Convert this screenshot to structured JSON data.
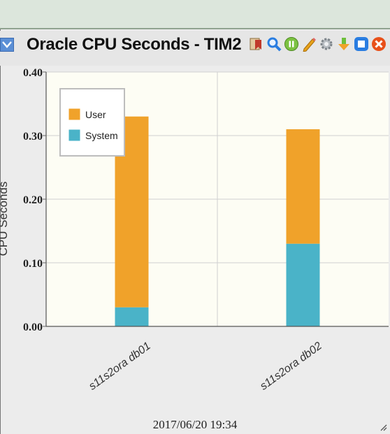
{
  "widget": {
    "title": "Oracle CPU Seconds - TIM2",
    "timestamp": "2017/06/20 19:34",
    "toolbar": [
      {
        "name": "bookmark-icon",
        "color": "#c0392b"
      },
      {
        "name": "search-icon",
        "color": "#2a7de1"
      },
      {
        "name": "pause-icon",
        "color": "#7cc242"
      },
      {
        "name": "edit-icon",
        "color": "#e8a21a"
      },
      {
        "name": "settings-icon",
        "color": "#9aa0a6"
      },
      {
        "name": "download-icon",
        "color": "#6dbf3b"
      },
      {
        "name": "maximize-icon",
        "color": "#2a7de1"
      },
      {
        "name": "close-icon",
        "color": "#e8501a"
      }
    ]
  },
  "chart_data": {
    "type": "bar",
    "stacked": true,
    "categories": [
      "s11s2ora db01",
      "s11s2ora db02"
    ],
    "series": [
      {
        "name": "System",
        "values": [
          0.03,
          0.13
        ],
        "color": "#4ab3c8"
      },
      {
        "name": "User",
        "values": [
          0.3,
          0.18
        ],
        "color": "#f0a22a"
      }
    ],
    "legend_order": [
      "User",
      "System"
    ],
    "legend_position": "top-left",
    "ylabel": "CPU Seconds",
    "ylim": [
      0,
      0.4
    ],
    "yticks": [
      "0.00",
      "0.10",
      "0.20",
      "0.30",
      "0.40"
    ],
    "grid": true,
    "background": "#fdfdf4"
  }
}
